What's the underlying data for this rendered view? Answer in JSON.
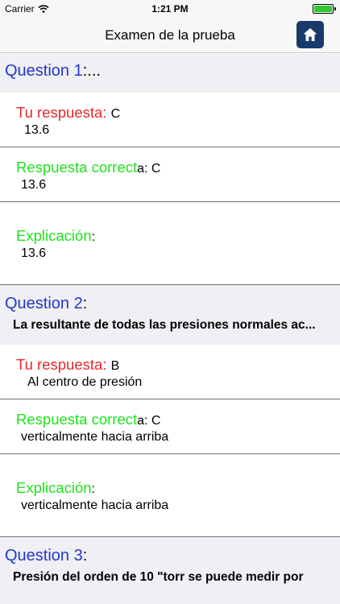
{
  "status_bar": {
    "carrier": "Carrier",
    "time": "1:21 PM",
    "battery_level": 1.0
  },
  "nav": {
    "title": "Examen de la prueba",
    "home_icon": "home-icon"
  },
  "colors": {
    "question_label": "#2338c9",
    "wrong_answer": "#e8262b",
    "correct_answer": "#1fe11f",
    "home_button_bg": "#173a6b"
  },
  "questions": [
    {
      "label": "Question 1",
      "suffix": ":...",
      "text": "",
      "your_answer_label": "Tu respuesta:",
      "your_answer_letter": "C",
      "your_answer_text": "13.6",
      "correct_label": "Respuesta correct",
      "correct_suffix": "a: C",
      "correct_text": "13.6",
      "explanation_label": "Explicación",
      "explanation_suffix": ":",
      "explanation_text": "13.6"
    },
    {
      "label": "Question 2",
      "suffix": ":",
      "text": "La resultante de todas las presiones normales ac...",
      "your_answer_label": "Tu respuesta:",
      "your_answer_letter": "B",
      "your_answer_text": "Al centro de presión",
      "correct_label": "Respuesta correct",
      "correct_suffix": "a: C",
      "correct_text": "verticalmente hacia arriba",
      "explanation_label": "Explicación",
      "explanation_suffix": ":",
      "explanation_text": "verticalmente hacia arriba"
    },
    {
      "label": "Question 3",
      "suffix": ":",
      "text": "Presión del orden de 10 \"torr se puede medir por"
    }
  ]
}
